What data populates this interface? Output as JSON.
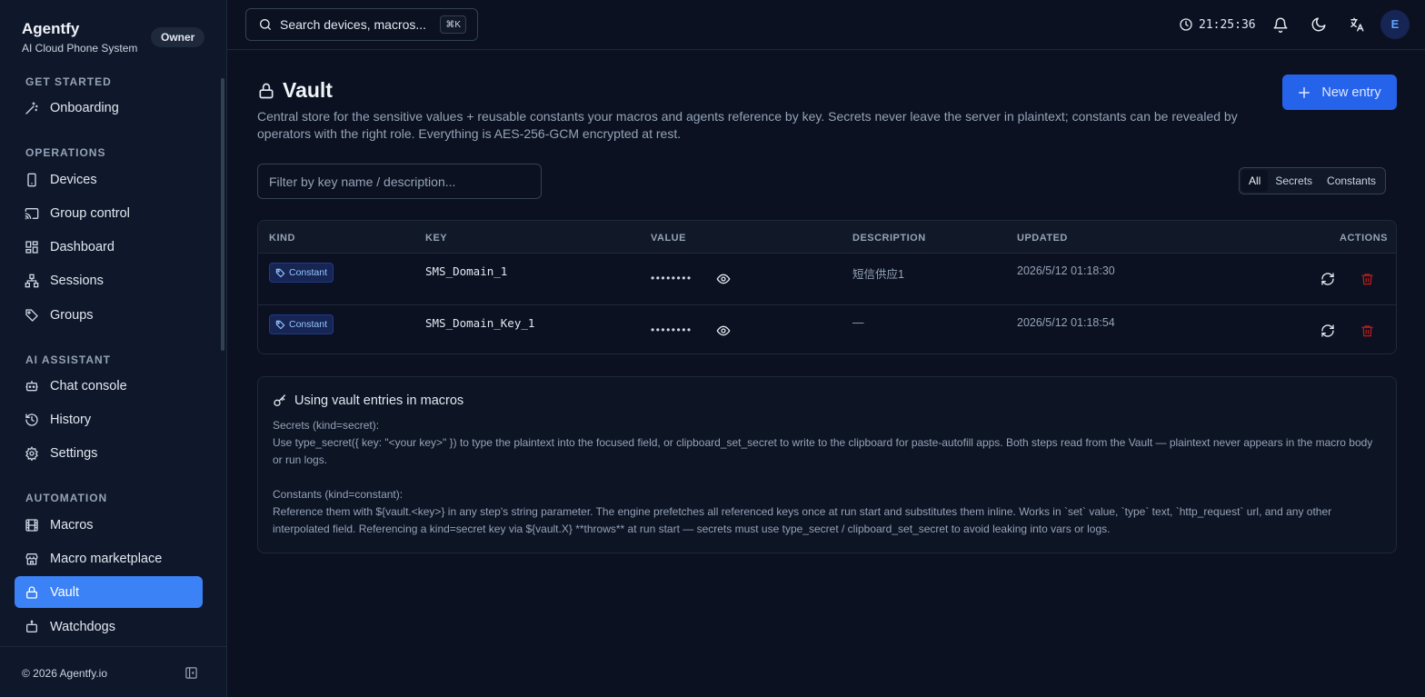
{
  "brand": {
    "name": "Agentfy",
    "subtitle": "AI Cloud Phone System",
    "role_badge": "Owner"
  },
  "sidebar": {
    "sections": [
      {
        "title": "GET STARTED",
        "items": [
          {
            "label": "Onboarding",
            "icon": "wand-icon"
          }
        ]
      },
      {
        "title": "OPERATIONS",
        "items": [
          {
            "label": "Devices",
            "icon": "phone-icon"
          },
          {
            "label": "Group control",
            "icon": "cast-icon"
          },
          {
            "label": "Dashboard",
            "icon": "dashboard-icon"
          },
          {
            "label": "Sessions",
            "icon": "network-icon"
          },
          {
            "label": "Groups",
            "icon": "tags-icon"
          }
        ]
      },
      {
        "title": "AI ASSISTANT",
        "items": [
          {
            "label": "Chat console",
            "icon": "bot-icon"
          },
          {
            "label": "History",
            "icon": "history-icon"
          },
          {
            "label": "Settings",
            "icon": "gear-icon"
          }
        ]
      },
      {
        "title": "AUTOMATION",
        "items": [
          {
            "label": "Macros",
            "icon": "film-icon"
          },
          {
            "label": "Macro marketplace",
            "icon": "store-icon"
          },
          {
            "label": "Vault",
            "icon": "lock-icon",
            "active": true
          },
          {
            "label": "Watchdogs",
            "icon": "robot-icon"
          }
        ]
      }
    ],
    "footer": "© 2026 Agentfy.io"
  },
  "topbar": {
    "search_text": "Search devices, macros...",
    "shortcut": "⌘K",
    "time": "21:25:36",
    "avatar_initial": "E"
  },
  "page": {
    "title": "Vault",
    "description": "Central store for the sensitive values + reusable constants your macros and agents reference by key. Secrets never leave the server in plaintext; constants can be revealed by operators with the right role. Everything is AES-256-GCM encrypted at rest.",
    "new_button": "New entry",
    "filter_placeholder": "Filter by key name / description...",
    "filter_tabs": [
      "All",
      "Secrets",
      "Constants"
    ],
    "active_tab": "All"
  },
  "table": {
    "columns": [
      "KIND",
      "KEY",
      "VALUE",
      "DESCRIPTION",
      "UPDATED",
      "ACTIONS"
    ],
    "rows": [
      {
        "kind": "Constant",
        "key": "SMS_Domain_1",
        "value": "••••••••",
        "description": "短信供应1",
        "updated": "2026/5/12 01:18:30"
      },
      {
        "kind": "Constant",
        "key": "SMS_Domain_Key_1",
        "value": "••••••••",
        "description": "—",
        "updated": "2026/5/12 01:18:54"
      }
    ]
  },
  "info": {
    "title": "Using vault entries in macros",
    "secrets_heading": "Secrets (kind=secret):",
    "secrets_text": "Use type_secret({ key: \"<your key>\" }) to type the plaintext into the focused field, or clipboard_set_secret to write to the clipboard for paste-autofill apps. Both steps read from the Vault — plaintext never appears in the macro body or run logs.",
    "constants_heading": "Constants (kind=constant):",
    "constants_text": "Reference them with ${vault.<key>} in any step's string parameter. The engine prefetches all referenced keys once at run start and substitutes them inline. Works in `set` value, `type` text, `http_request` url, and any other interpolated field. Referencing a kind=secret key via ${vault.X} **throws** at run start — secrets must use type_secret / clipboard_set_secret to avoid leaking into vars or logs."
  },
  "colors": {
    "accent": "#3b82f6",
    "button": "#2563eb",
    "danger": "#b91c1c",
    "background": "#0b1120"
  }
}
